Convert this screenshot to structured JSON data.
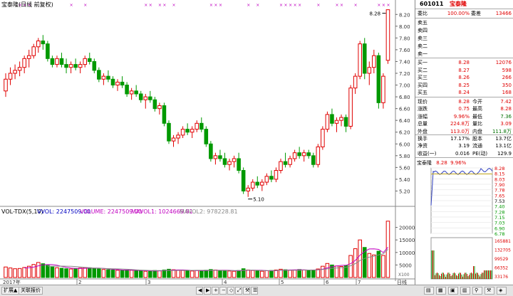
{
  "header": {
    "title": "宝泰隆(日线 前复权)",
    "peak_label": "8.28",
    "trough_label": "5.10"
  },
  "price_axis": [
    "8.20",
    "8.00",
    "7.80",
    "7.60",
    "7.40",
    "7.20",
    "7.00",
    "6.80",
    "6.60",
    "6.40",
    "6.20",
    "6.00",
    "5.80",
    "5.60",
    "5.40",
    "5.20"
  ],
  "vol_header": {
    "name": "VOL-TDX(5,10)",
    "vvol_label": "VVOL: 2247509.00",
    "volume_label": "VOLUME: 2247509.00",
    "mavol1_label": "MAVOL1: 1024669.81",
    "mavol2_label": "MAVOL2: 978228.81"
  },
  "vol_axis": [
    "20000",
    "15000",
    "10000",
    "5000"
  ],
  "vol_unit": "X100",
  "x_labels": [
    "2017年",
    "2",
    "3",
    "4",
    "5",
    "6",
    "7",
    "日线"
  ],
  "tabs": [
    "扩展▲",
    "关联报价"
  ],
  "quote": {
    "code": "601011",
    "name": "宝泰隆",
    "weibi_label": "委比",
    "weibi": "100.00%",
    "weicha_label": "委差",
    "weicha": "13466",
    "sell": [
      {
        "label": "卖五",
        "price": "",
        "vol": ""
      },
      {
        "label": "卖四",
        "price": "",
        "vol": ""
      },
      {
        "label": "卖三",
        "price": "",
        "vol": ""
      },
      {
        "label": "卖二",
        "price": "",
        "vol": ""
      },
      {
        "label": "卖一",
        "price": "",
        "vol": ""
      }
    ],
    "buy": [
      {
        "label": "买一",
        "price": "8.28",
        "vol": "12076"
      },
      {
        "label": "买二",
        "price": "8.27",
        "vol": "598"
      },
      {
        "label": "买三",
        "price": "8.26",
        "vol": "266"
      },
      {
        "label": "买四",
        "price": "8.25",
        "vol": "350"
      },
      {
        "label": "买五",
        "price": "8.24",
        "vol": "168"
      }
    ],
    "stats": [
      {
        "l": "现价",
        "v": "8.28",
        "vc": "red",
        "l2": "今开",
        "v2": "7.42",
        "v2c": "red"
      },
      {
        "l": "涨跌",
        "v": "0.75",
        "vc": "red",
        "l2": "最高",
        "v2": "8.28",
        "v2c": "red"
      },
      {
        "l": "涨幅",
        "v": "9.96%",
        "vc": "red",
        "l2": "最低",
        "v2": "7.36",
        "v2c": "green"
      },
      {
        "l": "总量",
        "v": "224.8万",
        "vc": "red",
        "l2": "量比",
        "v2": "3.09",
        "v2c": "red"
      },
      {
        "l": "外盘",
        "v": "113.0万",
        "vc": "red",
        "l2": "内盘",
        "v2": "111.8万",
        "v2c": "green"
      },
      {
        "l": "换手",
        "v": "17.17%",
        "vc": "",
        "l2": "股本",
        "v2": "13.7亿",
        "v2c": ""
      },
      {
        "l": "净资",
        "v": "3.19",
        "vc": "",
        "l2": "流通",
        "v2": "13.1亿",
        "v2c": ""
      },
      {
        "l": "收益(一)",
        "v": "0.016",
        "vc": "",
        "l2": "PE(动)",
        "v2": "129.9",
        "v2c": ""
      }
    ]
  },
  "mini": {
    "title": "宝泰隆",
    "price": "8.28",
    "pct": "9.96%",
    "price_ticks": [
      "8.28",
      "8.15",
      "8.03",
      "7.90",
      "7.78",
      "7.65",
      "7.53",
      "7.40",
      "7.28",
      "7.15",
      "7.03",
      "6.90",
      "6.78"
    ],
    "vol_ticks": [
      "165881",
      "132705",
      "99529",
      "66352",
      "33176"
    ]
  },
  "colors": {
    "up": "#e00000",
    "down": "#009900",
    "ma": "#c000c0",
    "bg": "#ffffff"
  },
  "chart_data": {
    "type": "candlestick",
    "title": "宝泰隆(日线 前复权)",
    "ylim": [
      5.0,
      8.3
    ],
    "ohlc": [
      [
        6.9,
        7.2,
        6.8,
        7.1
      ],
      [
        7.1,
        7.3,
        7.0,
        7.2
      ],
      [
        7.2,
        7.35,
        7.1,
        7.25
      ],
      [
        7.25,
        7.4,
        7.15,
        7.3
      ],
      [
        7.3,
        7.5,
        7.2,
        7.45
      ],
      [
        7.45,
        7.6,
        7.3,
        7.5
      ],
      [
        7.5,
        7.7,
        7.45,
        7.65
      ],
      [
        7.65,
        7.8,
        7.55,
        7.75
      ],
      [
        7.75,
        7.85,
        7.6,
        7.7
      ],
      [
        7.7,
        7.75,
        7.4,
        7.45
      ],
      [
        7.45,
        7.5,
        7.3,
        7.35
      ],
      [
        7.35,
        7.5,
        7.3,
        7.45
      ],
      [
        7.45,
        7.55,
        7.3,
        7.35
      ],
      [
        7.35,
        7.45,
        7.2,
        7.3
      ],
      [
        7.3,
        7.4,
        7.2,
        7.35
      ],
      [
        7.35,
        7.45,
        7.25,
        7.3
      ],
      [
        7.3,
        7.4,
        7.2,
        7.35
      ],
      [
        7.35,
        7.5,
        7.3,
        7.45
      ],
      [
        7.45,
        7.55,
        7.35,
        7.4
      ],
      [
        7.4,
        7.45,
        7.2,
        7.25
      ],
      [
        7.25,
        7.3,
        7.05,
        7.1
      ],
      [
        7.1,
        7.2,
        7.0,
        7.15
      ],
      [
        7.15,
        7.25,
        7.05,
        7.1
      ],
      [
        7.1,
        7.15,
        6.95,
        7.0
      ],
      [
        7.0,
        7.1,
        6.9,
        7.05
      ],
      [
        7.05,
        7.15,
        6.95,
        7.0
      ],
      [
        7.0,
        7.05,
        6.8,
        6.85
      ],
      [
        6.85,
        6.95,
        6.75,
        6.9
      ],
      [
        6.9,
        7.0,
        6.8,
        6.85
      ],
      [
        6.85,
        6.9,
        6.7,
        6.75
      ],
      [
        6.75,
        6.85,
        6.6,
        6.8
      ],
      [
        6.8,
        6.9,
        6.7,
        6.75
      ],
      [
        6.75,
        6.8,
        6.55,
        6.6
      ],
      [
        6.6,
        6.7,
        6.5,
        6.65
      ],
      [
        6.65,
        6.7,
        6.3,
        6.35
      ],
      [
        6.35,
        6.4,
        6.0,
        6.05
      ],
      [
        6.05,
        6.15,
        5.95,
        6.1
      ],
      [
        6.1,
        6.2,
        6.0,
        6.15
      ],
      [
        6.15,
        6.3,
        6.1,
        6.25
      ],
      [
        6.25,
        6.35,
        6.15,
        6.2
      ],
      [
        6.2,
        6.3,
        6.1,
        6.25
      ],
      [
        6.25,
        6.4,
        6.2,
        6.35
      ],
      [
        6.35,
        6.45,
        6.2,
        6.25
      ],
      [
        6.25,
        6.3,
        5.95,
        6.0
      ],
      [
        6.0,
        6.05,
        5.7,
        5.75
      ],
      [
        5.75,
        5.85,
        5.65,
        5.8
      ],
      [
        5.8,
        5.9,
        5.7,
        5.75
      ],
      [
        5.75,
        5.85,
        5.6,
        5.65
      ],
      [
        5.65,
        5.75,
        5.55,
        5.7
      ],
      [
        5.7,
        5.8,
        5.6,
        5.75
      ],
      [
        5.75,
        5.85,
        5.5,
        5.55
      ],
      [
        5.55,
        5.6,
        5.15,
        5.2
      ],
      [
        5.2,
        5.3,
        5.1,
        5.25
      ],
      [
        5.25,
        5.4,
        5.2,
        5.35
      ],
      [
        5.35,
        5.45,
        5.25,
        5.3
      ],
      [
        5.3,
        5.4,
        5.2,
        5.35
      ],
      [
        5.35,
        5.5,
        5.3,
        5.45
      ],
      [
        5.45,
        5.55,
        5.35,
        5.4
      ],
      [
        5.4,
        5.6,
        5.35,
        5.55
      ],
      [
        5.55,
        5.75,
        5.5,
        5.7
      ],
      [
        5.7,
        5.85,
        5.6,
        5.65
      ],
      [
        5.65,
        5.8,
        5.6,
        5.75
      ],
      [
        5.75,
        5.9,
        5.7,
        5.85
      ],
      [
        5.85,
        5.95,
        5.75,
        5.8
      ],
      [
        5.8,
        5.9,
        5.7,
        5.85
      ],
      [
        5.85,
        5.9,
        5.75,
        5.8
      ],
      [
        5.8,
        5.85,
        5.6,
        5.65
      ],
      [
        5.65,
        6.0,
        5.6,
        5.95
      ],
      [
        5.95,
        6.3,
        5.9,
        6.25
      ],
      [
        6.25,
        6.55,
        6.2,
        6.5
      ],
      [
        6.5,
        6.6,
        6.3,
        6.35
      ],
      [
        6.35,
        6.45,
        6.2,
        6.4
      ],
      [
        6.4,
        6.5,
        6.3,
        6.45
      ],
      [
        6.45,
        6.5,
        6.2,
        6.3
      ],
      [
        6.3,
        7.0,
        6.25,
        6.95
      ],
      [
        6.95,
        7.2,
        6.85,
        7.15
      ],
      [
        7.15,
        7.75,
        7.1,
        7.7
      ],
      [
        7.7,
        7.8,
        7.1,
        7.2
      ],
      [
        7.2,
        7.4,
        7.0,
        7.3
      ],
      [
        7.3,
        7.6,
        7.2,
        7.5
      ],
      [
        7.5,
        7.55,
        6.6,
        6.7
      ],
      [
        6.7,
        7.2,
        6.6,
        7.15
      ],
      [
        7.42,
        8.28,
        7.36,
        8.28
      ]
    ],
    "volume": [
      4200,
      3800,
      3500,
      3600,
      4000,
      4500,
      5200,
      6000,
      5500,
      4800,
      4200,
      3900,
      3700,
      3500,
      3400,
      3600,
      3800,
      4000,
      3900,
      3600,
      3400,
      3200,
      3100,
      3000,
      2900,
      2800,
      3000,
      2900,
      2700,
      2600,
      2500,
      2600,
      2800,
      2700,
      3000,
      3300,
      3100,
      2900,
      2800,
      2700,
      2600,
      2800,
      2700,
      2900,
      3200,
      3000,
      2800,
      2700,
      2600,
      2500,
      2800,
      3500,
      3000,
      2800,
      2600,
      2500,
      2700,
      2800,
      3000,
      3300,
      3100,
      2900,
      3000,
      3200,
      3000,
      2800,
      2900,
      3400,
      4500,
      5600,
      5000,
      4600,
      4400,
      4800,
      8800,
      11500,
      15000,
      12000,
      9600,
      9000,
      10500,
      8800,
      22500
    ],
    "mavol1": 1024669.81,
    "mavol2": 978228.81
  }
}
